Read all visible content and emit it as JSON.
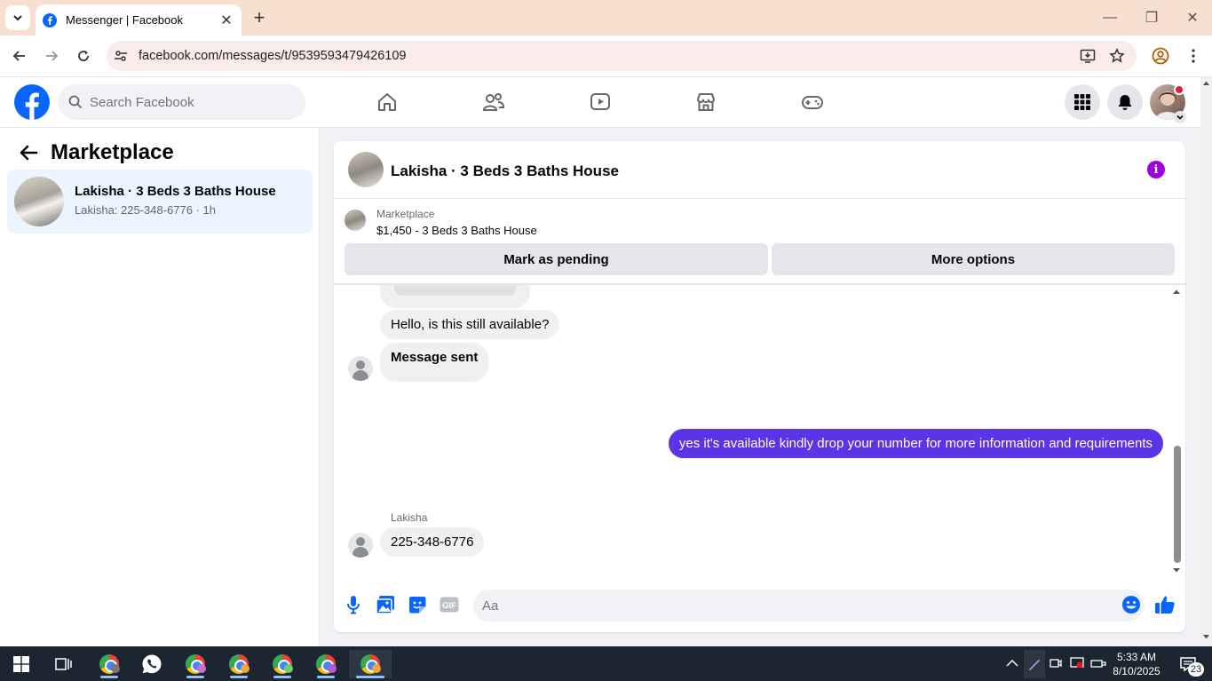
{
  "browser": {
    "tab_title": "Messenger | Facebook",
    "url": "facebook.com/messages/t/9539593479426109"
  },
  "fb_header": {
    "search_placeholder": "Search Facebook"
  },
  "sidebar": {
    "title": "Marketplace",
    "conversation": {
      "name": "Lakisha · 3 Beds 3 Baths House",
      "preview": "Lakisha: 225-348-6776 · 1h"
    }
  },
  "chat": {
    "header_title": "Lakisha · 3 Beds 3 Baths House",
    "listing_label": "Marketplace",
    "listing_price_title": "$1,450 - 3 Beds 3 Baths House",
    "mark_pending_label": "Mark as pending",
    "more_options_label": "More options",
    "messages": {
      "m1": "Hello, is this still available?",
      "m2": "Message sent",
      "m3": "yes it's available kindly drop your number for more information and requirements",
      "sender": "Lakisha",
      "m4": "225-348-6776"
    },
    "composer_placeholder": "Aa"
  },
  "taskbar": {
    "time": "5:33 AM",
    "date": "8/10/2025",
    "notifications": "23"
  },
  "colors": {
    "fb_blue": "#0866ff",
    "my_bubble": "#5b34e6",
    "info_purple": "#9a00e0"
  }
}
